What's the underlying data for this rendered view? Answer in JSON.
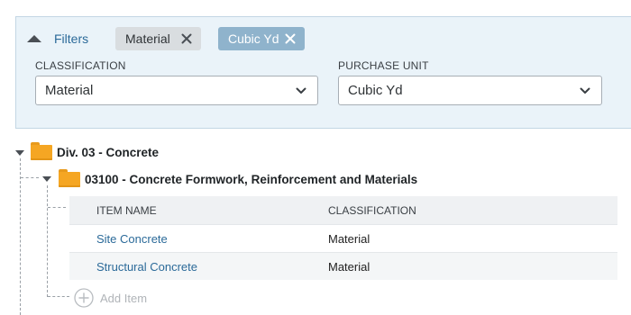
{
  "filters": {
    "toggle_label": "Filters",
    "chips": [
      {
        "label": "Material",
        "remove_icon": "close-icon"
      },
      {
        "label": "Cubic Yd",
        "remove_icon": "close-icon"
      }
    ],
    "classification": {
      "label": "CLASSIFICATION",
      "value": "Material"
    },
    "purchase_unit": {
      "label": "PURCHASE UNIT",
      "value": "Cubic Yd"
    }
  },
  "tree": {
    "division": {
      "label": "Div. 03 - Concrete",
      "icon": "folder-icon"
    },
    "section": {
      "label": "03100 - Concrete Formwork, Reinforcement and Materials",
      "icon": "folder-icon"
    }
  },
  "table": {
    "columns": [
      "ITEM NAME",
      "CLASSIFICATION"
    ],
    "rows": [
      {
        "name": "Site Concrete",
        "classification": "Material"
      },
      {
        "name": "Structural Concrete",
        "classification": "Material"
      }
    ]
  },
  "add_item": {
    "label": "Add Item",
    "icon": "plus-circle-icon"
  },
  "colors": {
    "panel_bg": "#eaf3f9",
    "link": "#2b6a99",
    "chip_active": "#8fb3cc",
    "chip_inactive": "#d9dde0",
    "folder": "#f5a623"
  }
}
